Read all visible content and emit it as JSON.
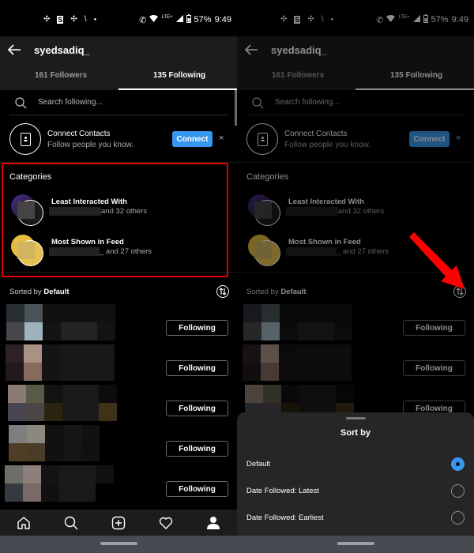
{
  "status_bar": {
    "battery": "57%",
    "time": "9:49",
    "network": "LTE+",
    "notification_icons": [
      "pinwheel-icon",
      "s-app-icon",
      "pinwheel-icon",
      "missed-call-icon",
      "dot-icon"
    ]
  },
  "header": {
    "username": "syedsadiq_",
    "back_icon": "arrow-left-icon"
  },
  "tabs": [
    {
      "label": "161 Followers",
      "active": false
    },
    {
      "label": "135 Following",
      "active": true
    }
  ],
  "search": {
    "placeholder": "Search following..."
  },
  "connect_contacts": {
    "title": "Connect Contacts",
    "subtitle": "Follow people you know.",
    "button_label": "Connect",
    "close_label": "×"
  },
  "categories": {
    "heading": "Categories",
    "items": [
      {
        "title": "Least Interacted With",
        "subtitle": "and 32 others"
      },
      {
        "title": "Most Shown in Feed",
        "subtitle": "_ and 27 others"
      }
    ]
  },
  "sort": {
    "prefix": "Sorted by ",
    "value": "Default"
  },
  "list": {
    "button_label": "Following",
    "rows": [
      {
        "colors": [
          "#2a2f33",
          "#4a5358",
          "#111",
          "#111",
          "#111",
          "#111",
          "#46484c",
          "#9fb3be",
          "#141414",
          "#232323",
          "#232323",
          "#141414"
        ]
      },
      {
        "colors": [
          "#2d2125",
          "#a89286",
          "#141414",
          "#181818",
          "#181818",
          "#181818",
          "#22191b",
          "#86695f",
          "#141414",
          "#171717",
          "#171717",
          "#171717"
        ]
      },
      {
        "colors": [
          "#8a7a73",
          "#5a5a48",
          "#141210",
          "#1a1a1a",
          "#1a1a1a",
          "#0c0c0c",
          "#484450",
          "#4a4646",
          "#2a2410",
          "#1a1a1a",
          "#1a1a1a",
          "#3e3218"
        ]
      },
      {
        "colors": [
          "#7e7e7e",
          "#8c8880",
          "#111",
          "#161616",
          "#111",
          "#000",
          "#4e3e26",
          "#4a3c28",
          "#111",
          "#151515",
          "#111",
          "#000"
        ]
      },
      {
        "colors": [
          "#6e6e68",
          "#8e7e7c",
          "#141414",
          "#1a1a1a",
          "#1a1a1a",
          "#111",
          "#343a40",
          "#7c6a68",
          "#111",
          "#1a1a1a",
          "#1a1a1a",
          "#000"
        ]
      }
    ]
  },
  "bottom_nav": {
    "items": [
      "home-icon",
      "search-icon",
      "new-post-icon",
      "heart-icon",
      "profile-icon"
    ]
  },
  "sort_sheet": {
    "title": "Sort by",
    "options": [
      {
        "label": "Default",
        "selected": true
      },
      {
        "label": "Date Followed: Latest",
        "selected": false
      },
      {
        "label": "Date Followed: Earliest",
        "selected": false
      }
    ]
  },
  "colors": {
    "accent_blue": "#3797f0",
    "highlight_red": "#e00000"
  }
}
